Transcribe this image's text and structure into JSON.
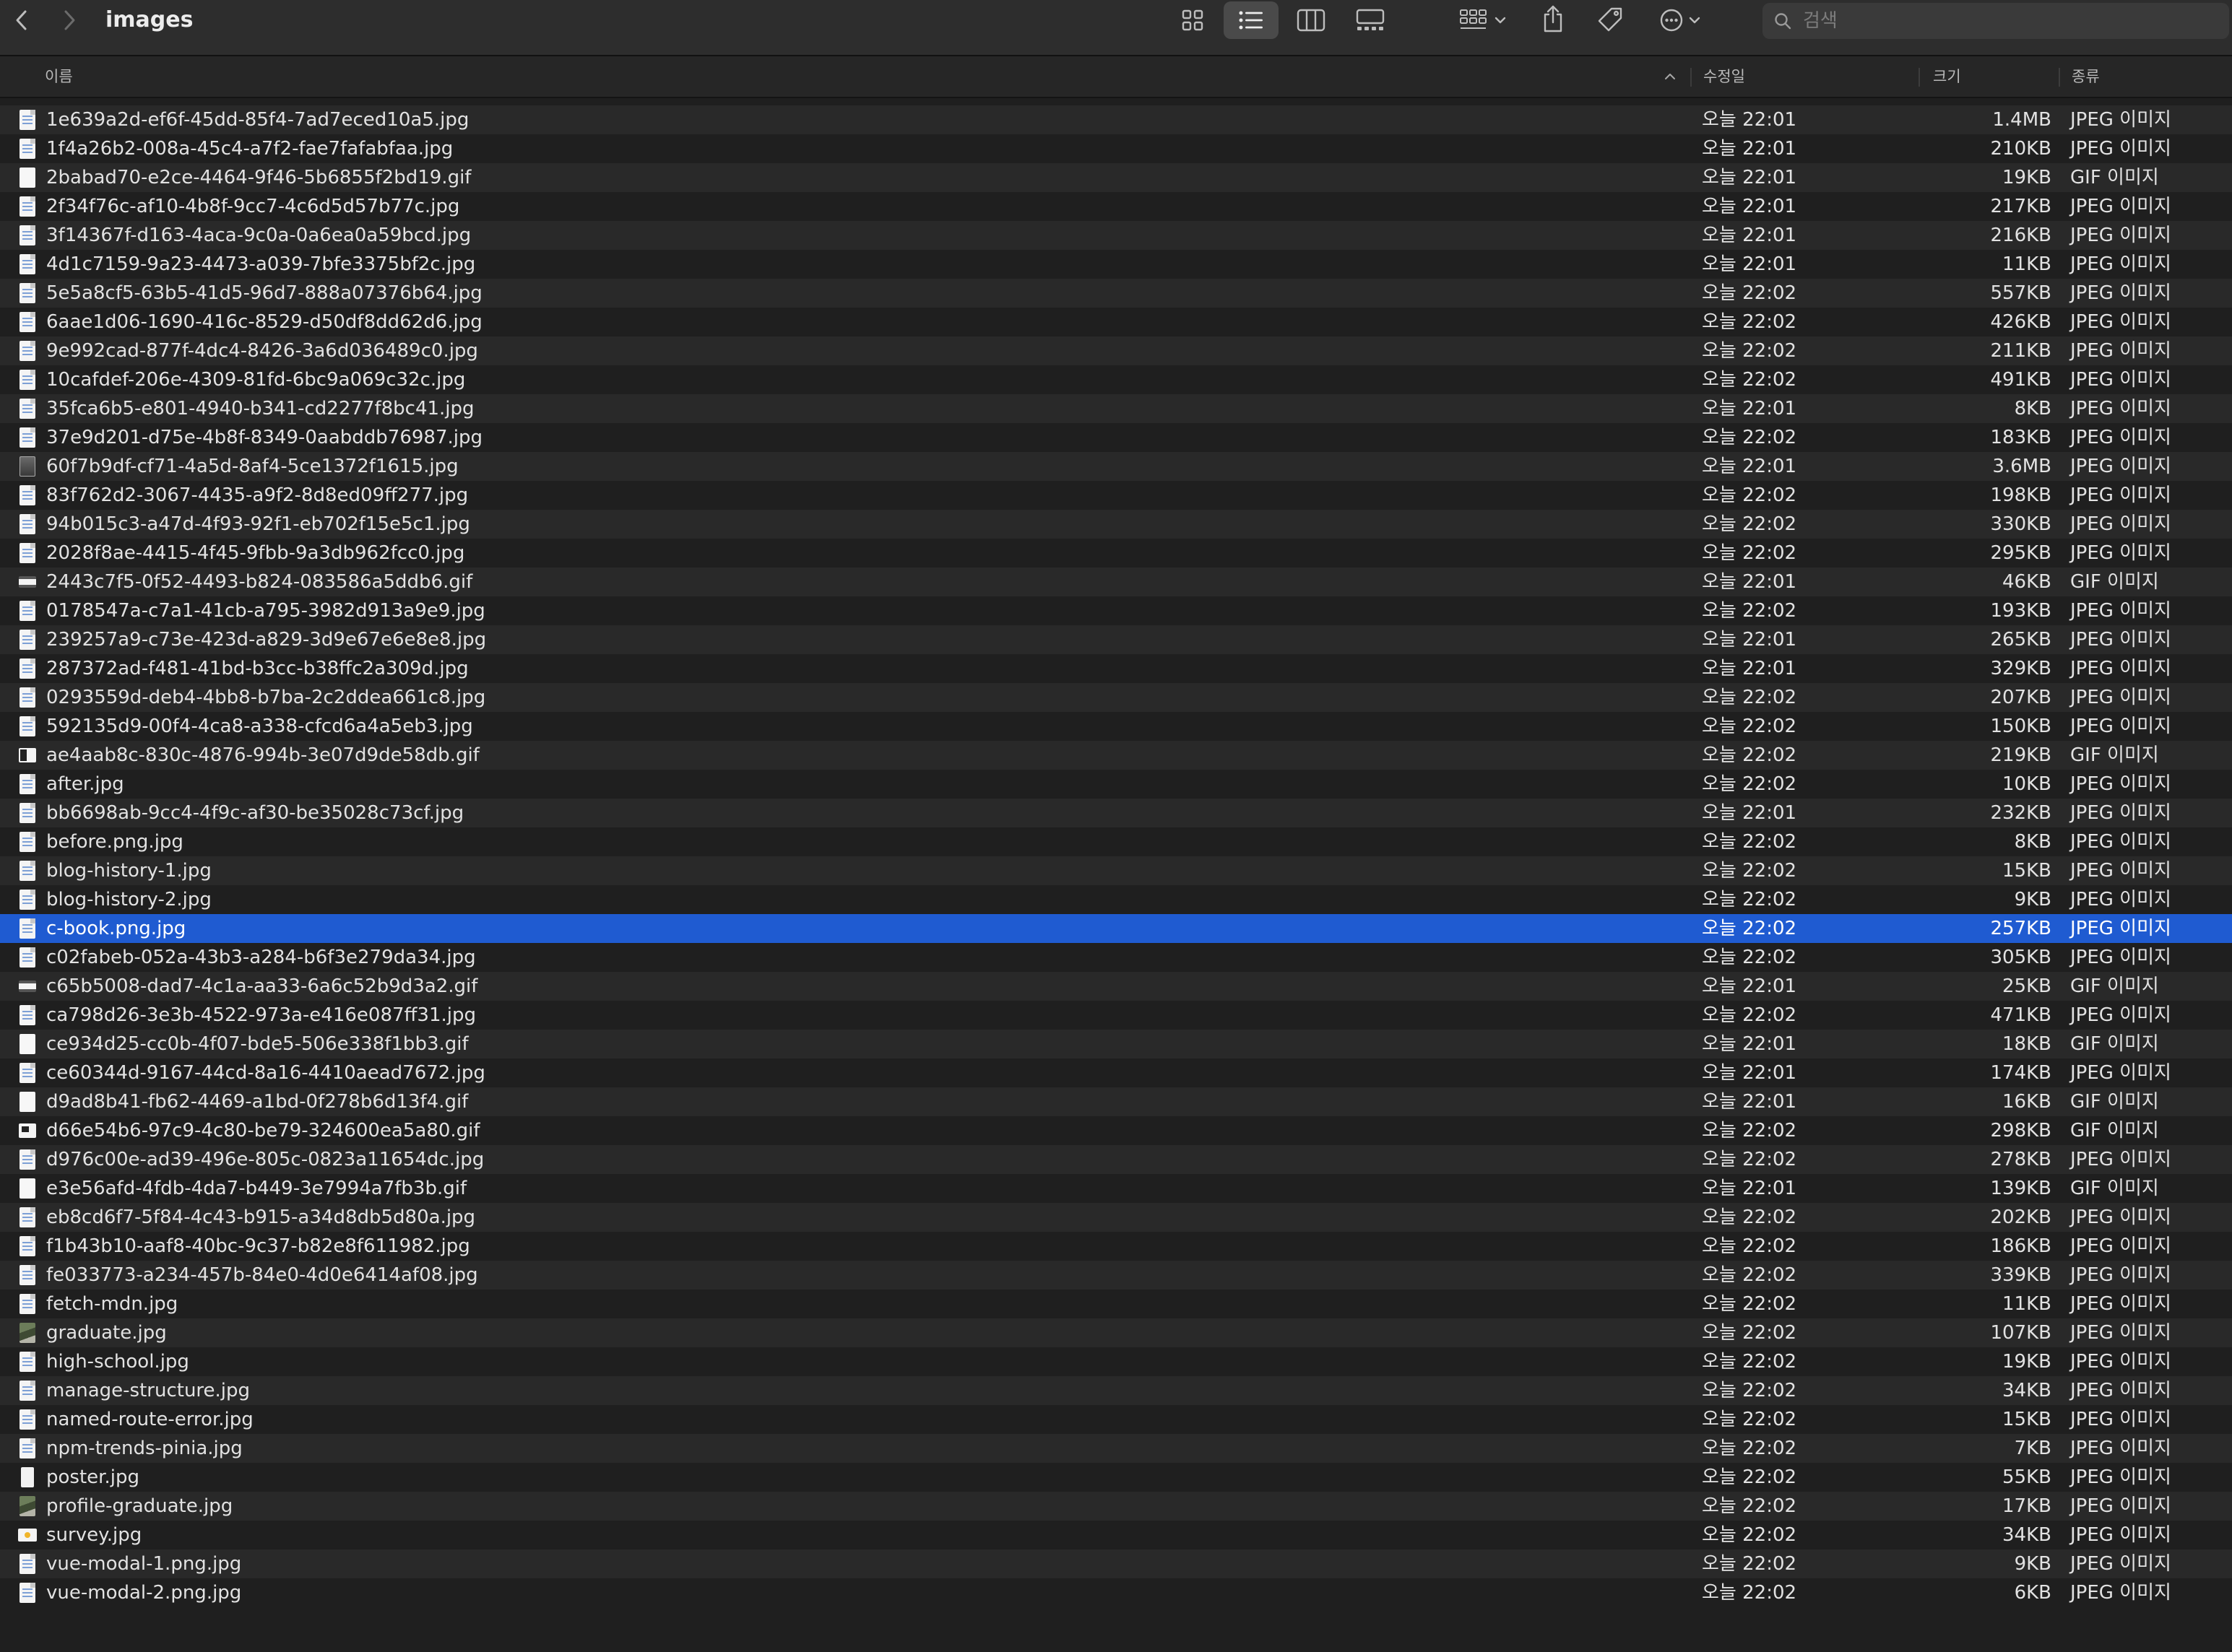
{
  "window": {
    "title": "images"
  },
  "search": {
    "placeholder": "검색"
  },
  "columns": {
    "name": "이름",
    "date": "수정일",
    "size": "크기",
    "kind": "종류"
  },
  "files": [
    {
      "icon": "doc",
      "name": "1e639a2d-ef6f-45dd-85f4-7ad7eced10a5.jpg",
      "date": "오늘 22:01",
      "size": "1.4MB",
      "kind": "JPEG 이미지"
    },
    {
      "icon": "doc",
      "name": "1f4a26b2-008a-45c4-a7f2-fae7fafabfaa.jpg",
      "date": "오늘 22:01",
      "size": "210KB",
      "kind": "JPEG 이미지"
    },
    {
      "icon": "blank",
      "name": "2babad70-e2ce-4464-9f46-5b6855f2bd19.gif",
      "date": "오늘 22:01",
      "size": "19KB",
      "kind": "GIF 이미지"
    },
    {
      "icon": "doc",
      "name": "2f34f76c-af10-4b8f-9cc7-4c6d5d57b77c.jpg",
      "date": "오늘 22:01",
      "size": "217KB",
      "kind": "JPEG 이미지"
    },
    {
      "icon": "doc",
      "name": "3f14367f-d163-4aca-9c0a-0a6ea0a59bcd.jpg",
      "date": "오늘 22:01",
      "size": "216KB",
      "kind": "JPEG 이미지"
    },
    {
      "icon": "doc",
      "name": "4d1c7159-9a23-4473-a039-7bfe3375bf2c.jpg",
      "date": "오늘 22:01",
      "size": "11KB",
      "kind": "JPEG 이미지"
    },
    {
      "icon": "doc",
      "name": "5e5a8cf5-63b5-41d5-96d7-888a07376b64.jpg",
      "date": "오늘 22:02",
      "size": "557KB",
      "kind": "JPEG 이미지"
    },
    {
      "icon": "doc",
      "name": "6aae1d06-1690-416c-8529-d50df8dd62d6.jpg",
      "date": "오늘 22:02",
      "size": "426KB",
      "kind": "JPEG 이미지"
    },
    {
      "icon": "doc",
      "name": "9e992cad-877f-4dc4-8426-3a6d036489c0.jpg",
      "date": "오늘 22:02",
      "size": "211KB",
      "kind": "JPEG 이미지"
    },
    {
      "icon": "doc",
      "name": "10cafdef-206e-4309-81fd-6bc9a069c32c.jpg",
      "date": "오늘 22:02",
      "size": "491KB",
      "kind": "JPEG 이미지"
    },
    {
      "icon": "doc",
      "name": "35fca6b5-e801-4940-b341-cd2277f8bc41.jpg",
      "date": "오늘 22:01",
      "size": "8KB",
      "kind": "JPEG 이미지"
    },
    {
      "icon": "doc",
      "name": "37e9d201-d75e-4b8f-8349-0aabddb76987.jpg",
      "date": "오늘 22:02",
      "size": "183KB",
      "kind": "JPEG 이미지"
    },
    {
      "icon": "dark",
      "name": "60f7b9df-cf71-4a5d-8af4-5ce1372f1615.jpg",
      "date": "오늘 22:01",
      "size": "3.6MB",
      "kind": "JPEG 이미지"
    },
    {
      "icon": "doc",
      "name": "83f762d2-3067-4435-a9f2-8d8ed09ff277.jpg",
      "date": "오늘 22:02",
      "size": "198KB",
      "kind": "JPEG 이미지"
    },
    {
      "icon": "doc",
      "name": "94b015c3-a47d-4f93-92f1-eb702f15e5c1.jpg",
      "date": "오늘 22:02",
      "size": "330KB",
      "kind": "JPEG 이미지"
    },
    {
      "icon": "doc",
      "name": "2028f8ae-4415-4f45-9fbb-9a3db962fcc0.jpg",
      "date": "오늘 22:02",
      "size": "295KB",
      "kind": "JPEG 이미지"
    },
    {
      "icon": "band",
      "name": "2443c7f5-0f52-4493-b824-083586a5ddb6.gif",
      "date": "오늘 22:01",
      "size": "46KB",
      "kind": "GIF 이미지"
    },
    {
      "icon": "doc",
      "name": "0178547a-c7a1-41cb-a795-3982d913a9e9.jpg",
      "date": "오늘 22:02",
      "size": "193KB",
      "kind": "JPEG 이미지"
    },
    {
      "icon": "doc",
      "name": "239257a9-c73e-423d-a829-3d9e67e6e8e8.jpg",
      "date": "오늘 22:01",
      "size": "265KB",
      "kind": "JPEG 이미지"
    },
    {
      "icon": "doc",
      "name": "287372ad-f481-41bd-b3cc-b38ffc2a309d.jpg",
      "date": "오늘 22:01",
      "size": "329KB",
      "kind": "JPEG 이미지"
    },
    {
      "icon": "doc",
      "name": "0293559d-deb4-4bb8-b7ba-2c2ddea661c8.jpg",
      "date": "오늘 22:02",
      "size": "207KB",
      "kind": "JPEG 이미지"
    },
    {
      "icon": "doc",
      "name": "592135d9-00f4-4ca8-a338-cfcd6a4a5eb3.jpg",
      "date": "오늘 22:02",
      "size": "150KB",
      "kind": "JPEG 이미지"
    },
    {
      "icon": "half",
      "name": "ae4aab8c-830c-4876-994b-3e07d9de58db.gif",
      "date": "오늘 22:02",
      "size": "219KB",
      "kind": "GIF 이미지"
    },
    {
      "icon": "doc",
      "name": "after.jpg",
      "date": "오늘 22:02",
      "size": "10KB",
      "kind": "JPEG 이미지"
    },
    {
      "icon": "doc",
      "name": "bb6698ab-9cc4-4f9c-af30-be35028c73cf.jpg",
      "date": "오늘 22:01",
      "size": "232KB",
      "kind": "JPEG 이미지"
    },
    {
      "icon": "doc",
      "name": "before.png.jpg",
      "date": "오늘 22:02",
      "size": "8KB",
      "kind": "JPEG 이미지"
    },
    {
      "icon": "doc",
      "name": "blog-history-1.jpg",
      "date": "오늘 22:02",
      "size": "15KB",
      "kind": "JPEG 이미지"
    },
    {
      "icon": "doc",
      "name": "blog-history-2.jpg",
      "date": "오늘 22:02",
      "size": "9KB",
      "kind": "JPEG 이미지"
    },
    {
      "icon": "doc",
      "name": "c-book.png.jpg",
      "date": "오늘 22:02",
      "size": "257KB",
      "kind": "JPEG 이미지",
      "selected": true
    },
    {
      "icon": "doc",
      "name": "c02fabeb-052a-43b3-a284-b6f3e279da34.jpg",
      "date": "오늘 22:02",
      "size": "305KB",
      "kind": "JPEG 이미지"
    },
    {
      "icon": "band",
      "name": "c65b5008-dad7-4c1a-aa33-6a6c52b9d3a2.gif",
      "date": "오늘 22:01",
      "size": "25KB",
      "kind": "GIF 이미지"
    },
    {
      "icon": "doc",
      "name": "ca798d26-3e3b-4522-973a-e416e087ff31.jpg",
      "date": "오늘 22:02",
      "size": "471KB",
      "kind": "JPEG 이미지"
    },
    {
      "icon": "blank",
      "name": "ce934d25-cc0b-4f07-bde5-506e338f1bb3.gif",
      "date": "오늘 22:01",
      "size": "18KB",
      "kind": "GIF 이미지"
    },
    {
      "icon": "doc",
      "name": "ce60344d-9167-44cd-8a16-4410aead7672.jpg",
      "date": "오늘 22:01",
      "size": "174KB",
      "kind": "JPEG 이미지"
    },
    {
      "icon": "blank",
      "name": "d9ad8b41-fb62-4469-a1bd-0f278b6d13f4.gif",
      "date": "오늘 22:01",
      "size": "16KB",
      "kind": "GIF 이미지"
    },
    {
      "icon": "corner",
      "name": "d66e54b6-97c9-4c80-be79-324600ea5a80.gif",
      "date": "오늘 22:02",
      "size": "298KB",
      "kind": "GIF 이미지"
    },
    {
      "icon": "doc",
      "name": "d976c00e-ad39-496e-805c-0823a11654dc.jpg",
      "date": "오늘 22:02",
      "size": "278KB",
      "kind": "JPEG 이미지"
    },
    {
      "icon": "blank",
      "name": "e3e56afd-4fdb-4da7-b449-3e7994a7fb3b.gif",
      "date": "오늘 22:01",
      "size": "139KB",
      "kind": "GIF 이미지"
    },
    {
      "icon": "doc",
      "name": "eb8cd6f7-5f84-4c43-b915-a34d8db5d80a.jpg",
      "date": "오늘 22:02",
      "size": "202KB",
      "kind": "JPEG 이미지"
    },
    {
      "icon": "doc",
      "name": "f1b43b10-aaf8-40bc-9c37-b82e8f611982.jpg",
      "date": "오늘 22:02",
      "size": "186KB",
      "kind": "JPEG 이미지"
    },
    {
      "icon": "doc",
      "name": "fe033773-a234-457b-84e0-4d0e6414af08.jpg",
      "date": "오늘 22:02",
      "size": "339KB",
      "kind": "JPEG 이미지"
    },
    {
      "icon": "doc",
      "name": "fetch-mdn.jpg",
      "date": "오늘 22:02",
      "size": "11KB",
      "kind": "JPEG 이미지"
    },
    {
      "icon": "photo",
      "name": "graduate.jpg",
      "date": "오늘 22:02",
      "size": "107KB",
      "kind": "JPEG 이미지"
    },
    {
      "icon": "doc",
      "name": "high-school.jpg",
      "date": "오늘 22:02",
      "size": "19KB",
      "kind": "JPEG 이미지"
    },
    {
      "icon": "doc",
      "name": "manage-structure.jpg",
      "date": "오늘 22:02",
      "size": "34KB",
      "kind": "JPEG 이미지"
    },
    {
      "icon": "doc",
      "name": "named-route-error.jpg",
      "date": "오늘 22:02",
      "size": "15KB",
      "kind": "JPEG 이미지"
    },
    {
      "icon": "doc",
      "name": "npm-trends-pinia.jpg",
      "date": "오늘 22:02",
      "size": "7KB",
      "kind": "JPEG 이미지"
    },
    {
      "icon": "tall",
      "name": "poster.jpg",
      "date": "오늘 22:02",
      "size": "55KB",
      "kind": "JPEG 이미지"
    },
    {
      "icon": "photo",
      "name": "profile-graduate.jpg",
      "date": "오늘 22:02",
      "size": "17KB",
      "kind": "JPEG 이미지"
    },
    {
      "icon": "wide",
      "name": "survey.jpg",
      "date": "오늘 22:02",
      "size": "34KB",
      "kind": "JPEG 이미지"
    },
    {
      "icon": "doc",
      "name": "vue-modal-1.png.jpg",
      "date": "오늘 22:02",
      "size": "9KB",
      "kind": "JPEG 이미지"
    },
    {
      "icon": "doc",
      "name": "vue-modal-2.png.jpg",
      "date": "오늘 22:02",
      "size": "6KB",
      "kind": "JPEG 이미지"
    }
  ],
  "colors": {
    "selection": "#1f5bd1",
    "row_alt": "#292929",
    "background": "#1f1f1f"
  }
}
